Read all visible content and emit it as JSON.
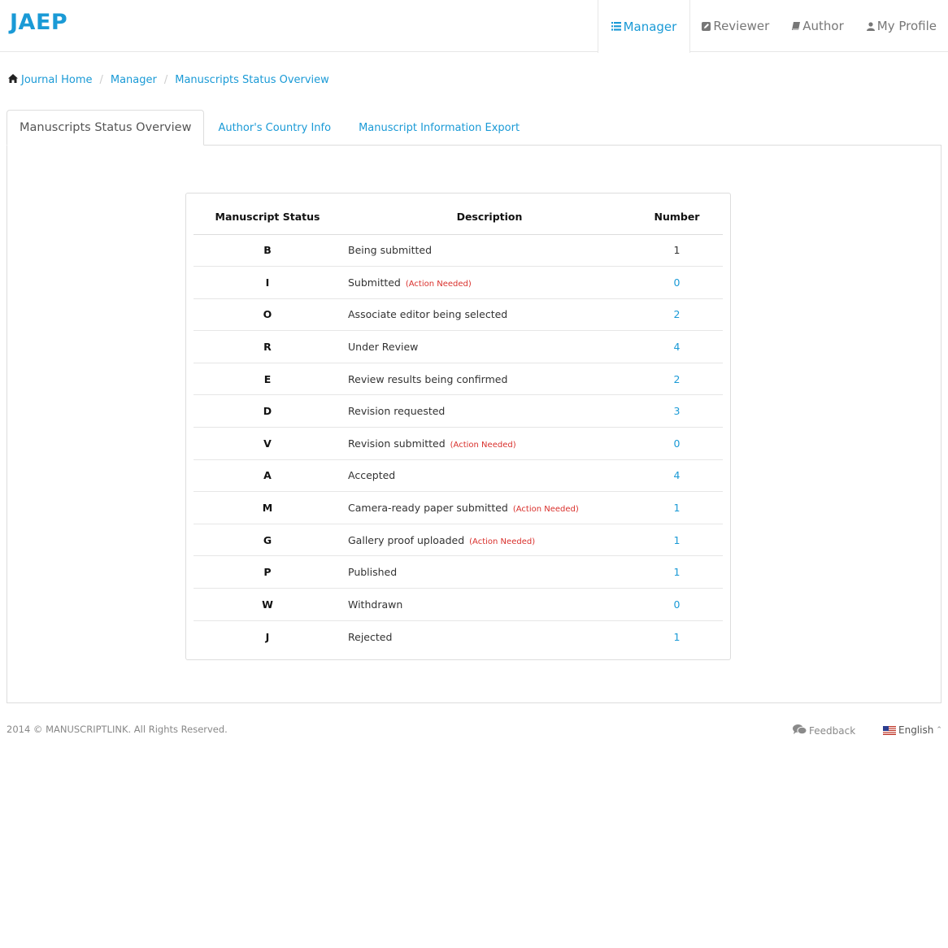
{
  "brand": "JAEP",
  "nav": {
    "items": [
      {
        "label": "Manager",
        "icon": "manager-icon",
        "active": true
      },
      {
        "label": "Reviewer",
        "icon": "reviewer-icon",
        "active": false
      },
      {
        "label": "Author",
        "icon": "author-icon",
        "active": false
      },
      {
        "label": "My Profile",
        "icon": "user-icon",
        "active": false
      }
    ]
  },
  "breadcrumb": {
    "items": [
      "Journal Home",
      "Manager",
      "Manuscripts Status Overview"
    ],
    "separator": "/"
  },
  "tabs": {
    "items": [
      {
        "label": "Manuscripts Status Overview",
        "active": true
      },
      {
        "label": "Author's Country Info",
        "active": false
      },
      {
        "label": "Manuscript Information Export",
        "active": false
      }
    ]
  },
  "table": {
    "headers": {
      "status": "Manuscript Status",
      "description": "Description",
      "number": "Number"
    },
    "action_needed_label": "(Action Needed)",
    "rows": [
      {
        "status": "B",
        "description": "Being submitted",
        "action": "",
        "number": "1",
        "link": false
      },
      {
        "status": "I",
        "description": "Submitted",
        "action": "(Action Needed)",
        "number": "0",
        "link": true
      },
      {
        "status": "O",
        "description": "Associate editor being selected",
        "action": "",
        "number": "2",
        "link": true
      },
      {
        "status": "R",
        "description": "Under Review",
        "action": "",
        "number": "4",
        "link": true
      },
      {
        "status": "E",
        "description": "Review results being confirmed",
        "action": "",
        "number": "2",
        "link": true
      },
      {
        "status": "D",
        "description": "Revision requested",
        "action": "",
        "number": "3",
        "link": true
      },
      {
        "status": "V",
        "description": "Revision submitted",
        "action": "(Action Needed)",
        "number": "0",
        "link": true
      },
      {
        "status": "A",
        "description": "Accepted",
        "action": "",
        "number": "4",
        "link": true
      },
      {
        "status": "M",
        "description": "Camera-ready paper submitted",
        "action": "(Action Needed)",
        "number": "1",
        "link": true
      },
      {
        "status": "G",
        "description": "Gallery proof uploaded",
        "action": "(Action Needed)",
        "number": "1",
        "link": true
      },
      {
        "status": "P",
        "description": "Published",
        "action": "",
        "number": "1",
        "link": true
      },
      {
        "status": "W",
        "description": "Withdrawn",
        "action": "",
        "number": "0",
        "link": true
      },
      {
        "status": "J",
        "description": "Rejected",
        "action": "",
        "number": "1",
        "link": true
      }
    ]
  },
  "footer": {
    "copyright": "2014 © MANUSCRIPTLINK. All Rights Reserved.",
    "feedback": "Feedback",
    "language": "English"
  },
  "colors": {
    "accent": "#1a9ad6",
    "action_needed": "#d9302c"
  }
}
